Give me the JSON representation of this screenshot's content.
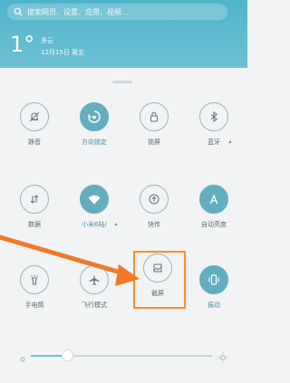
{
  "search": {
    "placeholder": "搜索网页、设置、应用、视频..."
  },
  "weather": {
    "temperature": "1°",
    "condition": "多云",
    "date": "12月15日 周五"
  },
  "toggles": [
    {
      "label": "静音",
      "icon": "bell-off-icon",
      "active": false
    },
    {
      "label": "方向锁定",
      "icon": "rotation-lock-icon",
      "active": true
    },
    {
      "label": "锁屏",
      "icon": "lock-icon",
      "active": false
    },
    {
      "label": "蓝牙",
      "icon": "bluetooth-icon",
      "active": false
    },
    {
      "label": "数据",
      "icon": "data-arrows-icon",
      "active": false
    },
    {
      "label": "小米6陆/",
      "icon": "wifi-icon",
      "active": true
    },
    {
      "label": "快传",
      "icon": "upload-icon",
      "active": false
    },
    {
      "label": "自动亮度",
      "icon": "auto-brightness-icon",
      "active": true
    },
    {
      "label": "手电筒",
      "icon": "flashlight-icon",
      "active": false
    },
    {
      "label": "飞行模式",
      "icon": "airplane-icon",
      "active": false
    },
    {
      "label": "截屏",
      "icon": "screenshot-icon",
      "active": false
    },
    {
      "label": "振动",
      "icon": "vibrate-icon",
      "active": true
    }
  ],
  "brightness": {
    "level": 0.2
  },
  "colors": {
    "header": "#4fb4c8",
    "active": "#63aebe",
    "highlight": "#ff8c2b",
    "arrow": "#f07a2a"
  }
}
